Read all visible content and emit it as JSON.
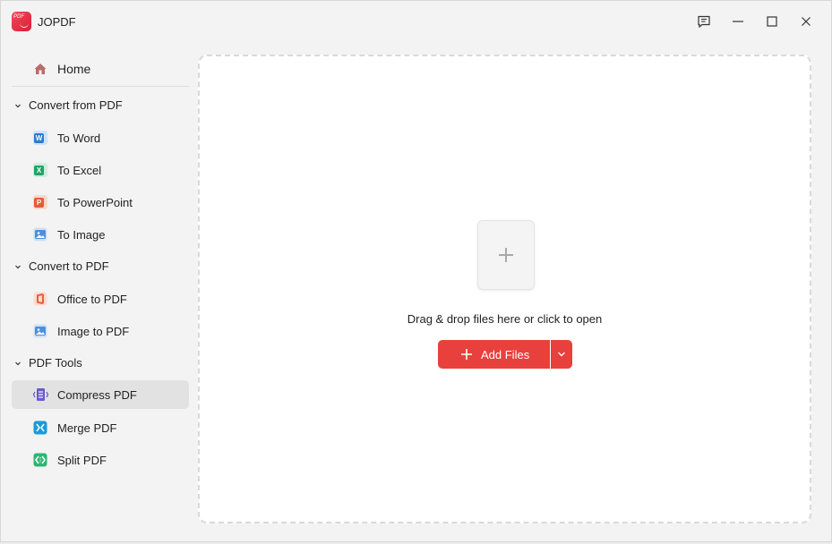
{
  "window": {
    "title": "JOPDF",
    "logo_text": "PDF",
    "controls": [
      "feedback-icon",
      "minimize-icon",
      "maximize-icon",
      "close-icon"
    ]
  },
  "sidebar": {
    "home": {
      "label": "Home",
      "icon": "home-icon"
    },
    "sections": [
      {
        "label": "Convert from PDF",
        "items": [
          {
            "label": "To Word",
            "icon": "word-icon",
            "letter": "W",
            "color": "#2b7cd3"
          },
          {
            "label": "To Excel",
            "icon": "excel-icon",
            "letter": "X",
            "color": "#21a366"
          },
          {
            "label": "To PowerPoint",
            "icon": "powerpoint-icon",
            "letter": "P",
            "color": "#e35b3a"
          },
          {
            "label": "To Image",
            "icon": "image-icon",
            "letter": "",
            "color": "#4a90e2"
          }
        ]
      },
      {
        "label": "Convert to PDF",
        "items": [
          {
            "label": "Office to PDF",
            "icon": "office-icon",
            "letter": "",
            "color": "#e8603c"
          },
          {
            "label": "Image to PDF",
            "icon": "image-icon",
            "letter": "",
            "color": "#4a90e2"
          }
        ]
      },
      {
        "label": "PDF Tools",
        "items": [
          {
            "label": "Compress PDF",
            "icon": "compress-icon",
            "letter": "",
            "color": "#6a5acd",
            "active": true
          },
          {
            "label": "Merge PDF",
            "icon": "merge-icon",
            "letter": "",
            "color": "#1a9bd7"
          },
          {
            "label": "Split PDF",
            "icon": "split-icon",
            "letter": "",
            "color": "#2bb673"
          }
        ]
      }
    ]
  },
  "main": {
    "drop_text": "Drag & drop files here or click to open",
    "add_button_label": "Add Files",
    "accent_color": "#e8403c"
  }
}
